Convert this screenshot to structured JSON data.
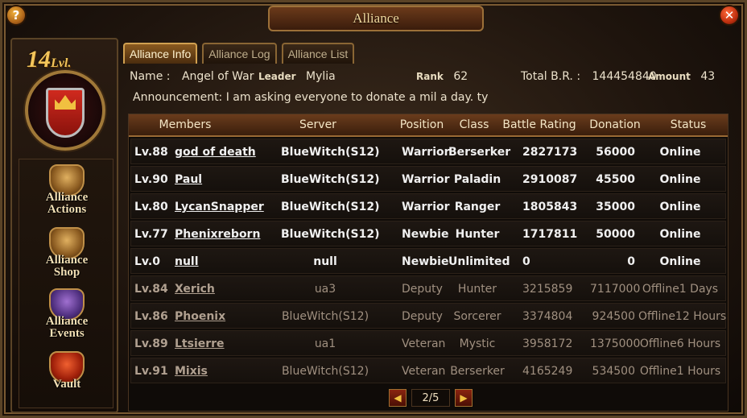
{
  "window": {
    "title": "Alliance",
    "help_label": "?",
    "close_label": "✕"
  },
  "sidebar": {
    "level_number": "14",
    "level_suffix": "Lvl.",
    "items": [
      {
        "label_line1": "Alliance",
        "label_line2": "Actions",
        "icon": "fortress-icon"
      },
      {
        "label_line1": "Alliance",
        "label_line2": "Shop",
        "icon": "shop-icon"
      },
      {
        "label_line1": "Alliance",
        "label_line2": "Events",
        "icon": "events-icon"
      },
      {
        "label_line1": "Vault",
        "label_line2": "",
        "icon": "vault-icon"
      }
    ]
  },
  "tabs": [
    {
      "label": "Alliance Info",
      "active": true
    },
    {
      "label": "Alliance Log",
      "active": false
    },
    {
      "label": "Alliance List",
      "active": false
    }
  ],
  "info": {
    "name_label": "Name :",
    "name_value": "Angel of War",
    "leader_label": "Leader",
    "leader_value": "Mylia",
    "rank_label": "Rank",
    "rank_value": "62",
    "total_br_label": "Total B.R. :",
    "total_br_value": "144454840",
    "amount_label": "Amount",
    "amount_value": "43",
    "announcement": "Announcement: I am asking everyone to donate a mil a day. ty"
  },
  "table": {
    "headers": [
      "Members",
      "Server",
      "Position",
      "Class",
      "Battle Rating",
      "Donation",
      "Status"
    ],
    "rows": [
      {
        "level": "Lv.88",
        "name": "god of death",
        "server": "BlueWitch(S12)",
        "position": "Warrior",
        "class": "Berserker",
        "rating": "2827173",
        "donation": "56000",
        "status": "Online",
        "online": true
      },
      {
        "level": "Lv.90",
        "name": "Paul",
        "server": "BlueWitch(S12)",
        "position": "Warrior",
        "class": "Paladin",
        "rating": "2910087",
        "donation": "45500",
        "status": "Online",
        "online": true
      },
      {
        "level": "Lv.80",
        "name": "LycanSnapper",
        "server": "BlueWitch(S12)",
        "position": "Warrior",
        "class": "Ranger",
        "rating": "1805843",
        "donation": "35000",
        "status": "Online",
        "online": true
      },
      {
        "level": "Lv.77",
        "name": "Phenixreborn",
        "server": "BlueWitch(S12)",
        "position": "Newbie",
        "class": "Hunter",
        "rating": "1717811",
        "donation": "50000",
        "status": "Online",
        "online": true
      },
      {
        "level": "Lv.0",
        "name": "null",
        "server": "null",
        "position": "Newbie",
        "class": "Unlimited",
        "rating": "0",
        "donation": "0",
        "status": "Online",
        "online": true
      },
      {
        "level": "Lv.84",
        "name": "Xerich",
        "server": "ua3",
        "position": "Deputy",
        "class": "Hunter",
        "rating": "3215859",
        "donation": "7117000",
        "status": "Offline1 Days",
        "online": false
      },
      {
        "level": "Lv.86",
        "name": "Phoenix",
        "server": "BlueWitch(S12)",
        "position": "Deputy",
        "class": "Sorcerer",
        "rating": "3374804",
        "donation": "924500",
        "status": "Offline12 Hours",
        "online": false
      },
      {
        "level": "Lv.89",
        "name": "Ltsierre",
        "server": "ua1",
        "position": "Veteran",
        "class": "Mystic",
        "rating": "3958172",
        "donation": "1375000",
        "status": "Offline6 Hours",
        "online": false
      },
      {
        "level": "Lv.91",
        "name": "Mixis",
        "server": "BlueWitch(S12)",
        "position": "Veteran",
        "class": "Berserker",
        "rating": "4165249",
        "donation": "534500",
        "status": "Offline1 Hours",
        "online": false
      }
    ]
  },
  "pager": {
    "page": "2/5",
    "prev": "◀",
    "next": "▶"
  }
}
